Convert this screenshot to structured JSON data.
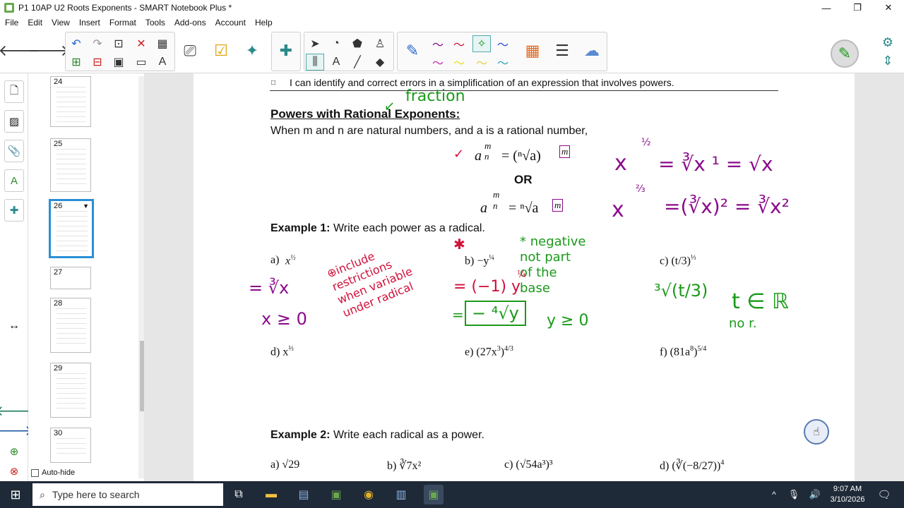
{
  "window": {
    "title": "P1 10AP U2 Roots Exponents - SMART Notebook Plus *",
    "controls": [
      "—",
      "❐",
      "✕"
    ]
  },
  "menu": [
    "File",
    "Edit",
    "View",
    "Insert",
    "Format",
    "Tools",
    "Add-ons",
    "Account",
    "Help"
  ],
  "sorter": {
    "pages": [
      "24",
      "25",
      "26",
      "27",
      "28",
      "29",
      "30"
    ],
    "selected": "26",
    "autohide_label": "Auto-hide"
  },
  "page": {
    "objective": "I can identify and correct errors in a simplification of an expression that involves powers.",
    "heading": "Powers with Rational Exponents:",
    "intro": "When m and n are natural numbers, and a is a rational number,",
    "or_label": "OR",
    "example1_title": "Example 1:",
    "example1_text": "Write each power as a radical.",
    "ex1_items": {
      "a_label": "a)",
      "b_label": "b) −y",
      "c_label": "c)",
      "d_label": "d) x",
      "e_label": "e) (27x",
      "f_label": "f) (81a"
    },
    "example2_title": "Example 2:",
    "example2_text": "Write each radical as a power.",
    "ex2_items": {
      "a": "a)  √29",
      "b": "b) ∛7x²",
      "c": "c) (√54a³)³",
      "d": "d)"
    }
  },
  "ink": {
    "fraction": "fraction",
    "negative_note": "* negative\nnot part\nof the\nbase",
    "include_note": "⊕include\nrestrictions\nwhen variable\nunder radical",
    "a_work": "= ∛x",
    "a_restriction": "x ≥ 0",
    "b_work": "= (−1) y",
    "b_answer": "− ⁴√y",
    "b_restriction": "y ≥ 0",
    "c_work": "³√(t/3)",
    "c_domain": "t ∈ ℝ",
    "c_note": "no r.",
    "x_half": "x",
    "x_half_rhs": "= ∛x ¹ = √x",
    "x_two_thirds": "x",
    "x_two_thirds_rhs": "=(∛x)² = ∛x²"
  },
  "taskbar": {
    "search_placeholder": "Type here to search",
    "time": "9:07 AM",
    "date": "3/10/2026"
  }
}
